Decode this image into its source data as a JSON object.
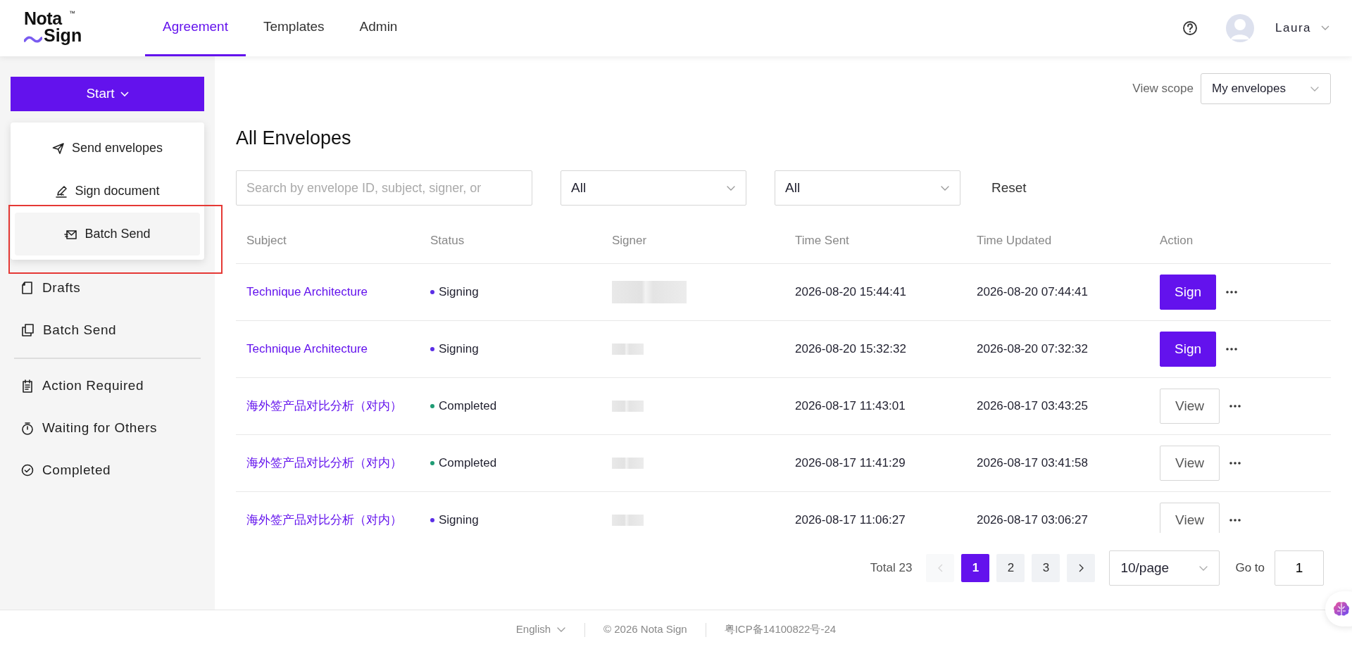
{
  "logo": {
    "line1": "Nota",
    "mark": "™",
    "line2": "Sign"
  },
  "nav_tabs": [
    {
      "label": "Agreement",
      "selected": true
    },
    {
      "label": "Templates",
      "selected": false
    },
    {
      "label": "Admin",
      "selected": false
    }
  ],
  "user": {
    "name": "Laura"
  },
  "start_button": {
    "label": "Start"
  },
  "start_menu": [
    {
      "label": "Send envelopes",
      "kind": "send",
      "selected": false,
      "annotated": false
    },
    {
      "label": "Sign document",
      "kind": "sign",
      "selected": false,
      "annotated": false
    },
    {
      "label": "Batch Send",
      "kind": "batch",
      "selected": true,
      "annotated": true
    }
  ],
  "sidebar": {
    "items": [
      {
        "label": "Drafts",
        "kind": "drafts",
        "divider_before": false
      },
      {
        "label": "Batch Send",
        "kind": "batch",
        "divider_before": false
      },
      {
        "label": "Action Required",
        "kind": "action",
        "divider_before": true
      },
      {
        "label": "Waiting for Others",
        "kind": "waiting",
        "divider_before": false
      },
      {
        "label": "Completed",
        "kind": "completed",
        "divider_before": false
      }
    ]
  },
  "view_scope": {
    "label": "View scope",
    "value": "My envelopes"
  },
  "title": "All Envelopes",
  "filters": {
    "search_placeholder": "Search by envelope ID, subject, signer, or",
    "selects": [
      "All",
      "All"
    ],
    "reset": "Reset"
  },
  "table": {
    "columns": [
      "Subject",
      "Status",
      "Signer",
      "Time Sent",
      "Time Updated",
      "Action"
    ],
    "rows": [
      {
        "subject": "Technique Architecture",
        "status": {
          "label": "Signing",
          "color": "#5b2ee6"
        },
        "signer": {
          "kind": "wideblur"
        },
        "time_sent": "2026-08-20 15:44:41",
        "time_updated": "2026-08-20 07:44:41",
        "action": {
          "label": "Sign",
          "kind": "primary"
        }
      },
      {
        "subject": "Technique Architecture",
        "status": {
          "label": "Signing",
          "color": "#5b2ee6"
        },
        "signer": {
          "kind": "blur"
        },
        "time_sent": "2026-08-20 15:32:32",
        "time_updated": "2026-08-20 07:32:32",
        "action": {
          "label": "Sign",
          "kind": "primary"
        }
      },
      {
        "subject": "海外签产品对比分析（对内）",
        "status": {
          "label": "Completed",
          "color": "#1f9b74"
        },
        "signer": {
          "kind": "blur"
        },
        "time_sent": "2026-08-17 11:43:01",
        "time_updated": "2026-08-17 03:43:25",
        "action": {
          "label": "View",
          "kind": "outline"
        }
      },
      {
        "subject": "海外签产品对比分析（对内）",
        "status": {
          "label": "Completed",
          "color": "#1f9b74"
        },
        "signer": {
          "kind": "blur"
        },
        "time_sent": "2026-08-17 11:41:29",
        "time_updated": "2026-08-17 03:41:58",
        "action": {
          "label": "View",
          "kind": "outline"
        }
      },
      {
        "subject": "海外签产品对比分析（对内）",
        "status": {
          "label": "Signing",
          "color": "#5b2ee6"
        },
        "signer": {
          "kind": "blur"
        },
        "time_sent": "2026-08-17 11:06:27",
        "time_updated": "2026-08-17 03:06:27",
        "action": {
          "label": "View",
          "kind": "outline"
        }
      }
    ]
  },
  "pagination": {
    "total": "Total 23",
    "prev_disabled": true,
    "next_disabled": false,
    "pages": [
      {
        "label": "1",
        "selected": true
      },
      {
        "label": "2",
        "selected": false
      },
      {
        "label": "3",
        "selected": false
      }
    ],
    "page_size": "10/page",
    "goto_label": "Go to",
    "goto_value": "1"
  },
  "footer": {
    "language": "English",
    "copyright": "© 2026 Nota Sign",
    "icp": "粤ICP备14100822号-24"
  }
}
